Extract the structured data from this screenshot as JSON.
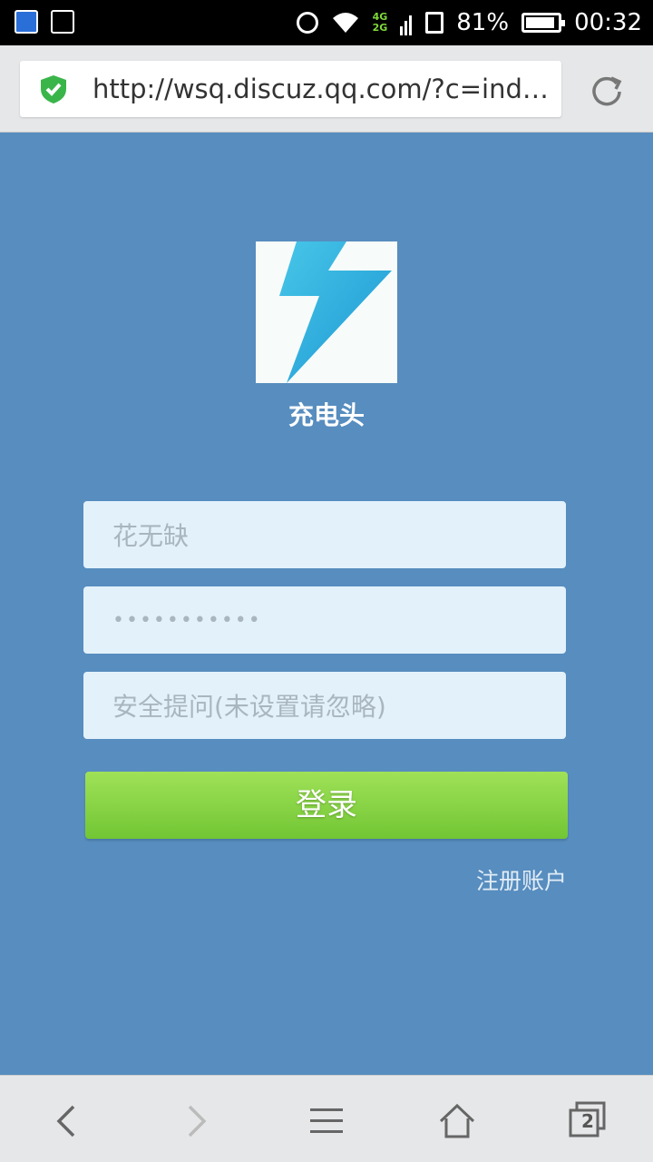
{
  "status_bar": {
    "network_top": "4G",
    "network_bottom": "2G",
    "battery": "81%",
    "time": "00:32",
    "icons": [
      "bird-app-icon",
      "image-icon",
      "alarm-icon",
      "wifi-icon",
      "signal-icon",
      "sim-alert-icon",
      "battery-icon"
    ]
  },
  "browser": {
    "url": "http://wsq.discuz.qq.com/?c=inde…",
    "secure_icon": "shield-check-icon",
    "reload_icon": "reload-icon",
    "tab_count": "2"
  },
  "app": {
    "name": "充电头",
    "logo_icon": "lightning-bolt-icon"
  },
  "form": {
    "username_value": "花无缺",
    "password_mask": "•••••••••••",
    "security_question_placeholder": "安全提问(未设置请忽略)",
    "login_label": "登录",
    "register_label": "注册账户"
  },
  "colors": {
    "background": "#578dbf",
    "field_bg": "#e3f1fb",
    "button_green": "#7fcd3c",
    "logo_blue": "#2aa3d6"
  }
}
